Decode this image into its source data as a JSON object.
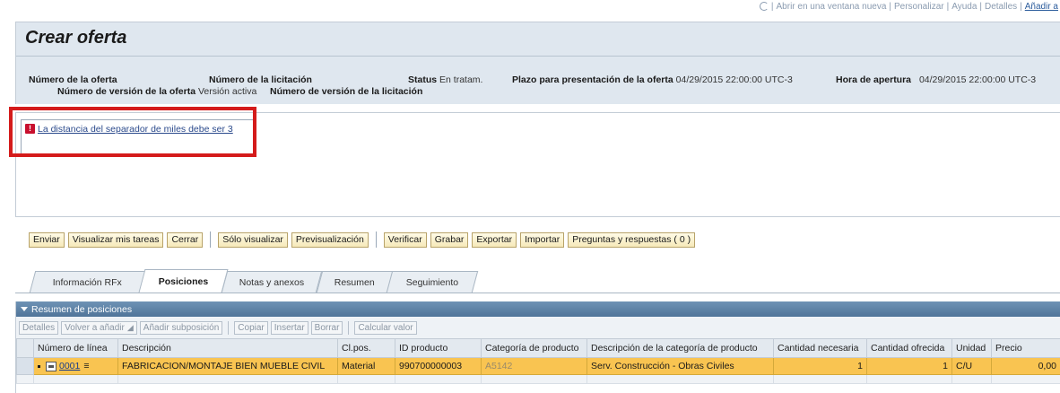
{
  "top_links": {
    "items": [
      "Abrir en una ventana nueva",
      "Personalizar",
      "Ayuda",
      "Detalles"
    ],
    "last": "Añadir a"
  },
  "page": {
    "title": "Crear oferta"
  },
  "header_fields": {
    "offer_number_label": "Número de la oferta",
    "tender_number_label": "Número de la licitación",
    "status_label": "Status",
    "status_value": "En tratam.",
    "deadline_label": "Plazo para presentación de la oferta",
    "deadline_value": "04/29/2015 22:00:00 UTC-3",
    "opening_label": "Hora de apertura",
    "opening_value": "04/29/2015 22:00:00 UTC-3",
    "offer_version_label": "Número de versión de la oferta",
    "offer_version_value": "Versión activa",
    "tender_version_label": "Número de versión de la licitación"
  },
  "message": {
    "text": "La distancia del separador de miles debe ser 3",
    "icon": "error-icon"
  },
  "toolbar": {
    "group1": [
      "Enviar",
      "Visualizar mis tareas",
      "Cerrar"
    ],
    "group2": [
      "Sólo visualizar",
      "Previsualización"
    ],
    "group3": [
      "Verificar",
      "Grabar",
      "Exportar",
      "Importar",
      "Preguntas y respuestas ( 0 )"
    ]
  },
  "tabs": [
    "Información RFx",
    "Posiciones",
    "Notas y anexos",
    "Resumen",
    "Seguimiento"
  ],
  "active_tab": "Posiciones",
  "positions": {
    "panel_title": "Resumen de posiciones",
    "buttons": {
      "detalles": "Detalles",
      "volver": "Volver a añadir",
      "subpos": "Añadir subposición",
      "copiar": "Copiar",
      "insertar": "Insertar",
      "borrar": "Borrar",
      "calcular": "Calcular valor"
    },
    "columns": [
      "Número de línea",
      "Descripción",
      "Cl.pos.",
      "ID producto",
      "Categoría de producto",
      "Descripción de la categoría de producto",
      "Cantidad necesaria",
      "Cantidad ofrecida",
      "Unidad",
      "Precio"
    ],
    "row": {
      "line": "0001",
      "description": "FABRICACION/MONTAJE BIEN MUEBLE CIVIL",
      "clpos": "Material",
      "product_id": "990700000003",
      "category": "A5142",
      "category_desc": "Serv. Construcción - Obras Civiles",
      "qty_needed": "1",
      "qty_offered": "1",
      "unit": "C/U",
      "price": "0,00"
    }
  },
  "colors": {
    "highlight_border": "#d41b1b",
    "selected_row": "#f9c451",
    "panel_header": "#4f7499"
  }
}
